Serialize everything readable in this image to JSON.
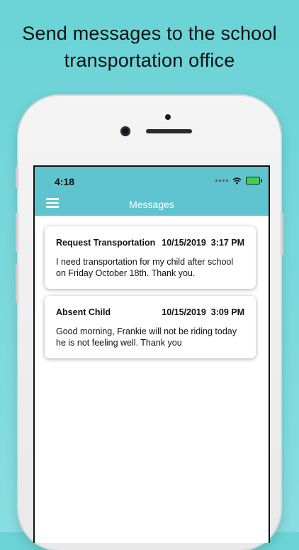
{
  "headline": {
    "line1": "Send messages to the school",
    "line2": "transportation office"
  },
  "status_bar": {
    "time": "4:18"
  },
  "app_bar": {
    "title": "Messages",
    "menu_icon": "hamburger-menu-icon"
  },
  "messages": [
    {
      "subject": "Request Transportation",
      "datetime": "10/15/2019  3:17 PM",
      "body_line1": "I need transportation for my child after school",
      "body_line2": "on Friday October 18th. Thank you."
    },
    {
      "subject": "Absent Child",
      "datetime": "10/15/2019  3:09 PM",
      "body_line1": "Good morning, Frankie will not be riding today",
      "body_line2": "he is not feeling well. Thank you"
    }
  ],
  "colors": {
    "background": "#6ad3d6",
    "app_bar": "#5fc4cf",
    "battery": "#3bd14a"
  }
}
